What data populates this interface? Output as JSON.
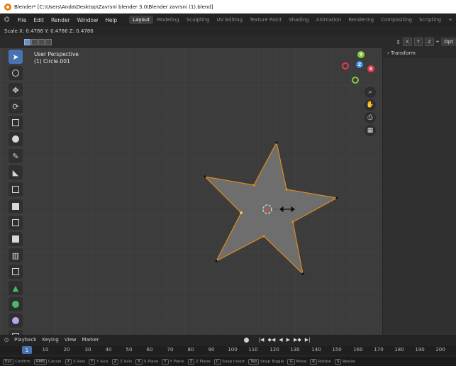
{
  "window": {
    "title": "Blender* [C:\\Users\\Anda\\Desktop\\Zavrsni blender 3.0\\Blender zavrsni (1).blend]"
  },
  "menu": {
    "items": [
      "File",
      "Edit",
      "Render",
      "Window",
      "Help"
    ],
    "workspaces": [
      "Layout",
      "Modeling",
      "Sculpting",
      "UV Editing",
      "Texture Paint",
      "Shading",
      "Animation",
      "Rendering",
      "Compositing",
      "Scripting",
      "+"
    ],
    "active_workspace": "Layout"
  },
  "scale_readout": "Scale X: 0.4786  Y: 0.4786  Z: 0.4786",
  "header": {
    "axis_toggles": [
      "X",
      "Y",
      "Z"
    ],
    "options_label": "Opt"
  },
  "viewport": {
    "view_name": "User Perspective",
    "object_name": "(1) Circle.001",
    "gizmo_axes": [
      "X",
      "Y",
      "Z"
    ],
    "gizmo_colors": {
      "x": "#e8394f",
      "y": "#8cc63f",
      "z": "#3b8fe5"
    },
    "selection_color": "#e08a1b",
    "mesh_fill": "#6e6e6e"
  },
  "npanel": {
    "header": "Transform"
  },
  "timeline": {
    "menus": [
      "Playback",
      "Keying",
      "View",
      "Marker"
    ],
    "current_frame": "1",
    "ruler_ticks": [
      "10",
      "20",
      "30",
      "40",
      "50",
      "60",
      "70",
      "80",
      "90",
      "100",
      "110",
      "120",
      "130",
      "140",
      "150",
      "160",
      "170",
      "180",
      "190",
      "200"
    ]
  },
  "statusbar": {
    "items": [
      {
        "key": "Esc",
        "label": "Confirm"
      },
      {
        "key": "RMB",
        "label": "Cancel"
      },
      {
        "key": "X",
        "label": "X Axis"
      },
      {
        "key": "Y",
        "label": "Y Axis"
      },
      {
        "key": "Z",
        "label": "Z Axis"
      },
      {
        "key": "X",
        "label": "X Plane"
      },
      {
        "key": "Y",
        "label": "Y Plane"
      },
      {
        "key": "Z",
        "label": "Z Plane"
      },
      {
        "key": "C",
        "label": "Snap Invert"
      },
      {
        "key": "Tab",
        "label": "Snap Toggle"
      },
      {
        "key": "G",
        "label": "Move"
      },
      {
        "key": "R",
        "label": "Rotate"
      },
      {
        "key": "S",
        "label": "Resize"
      }
    ]
  }
}
